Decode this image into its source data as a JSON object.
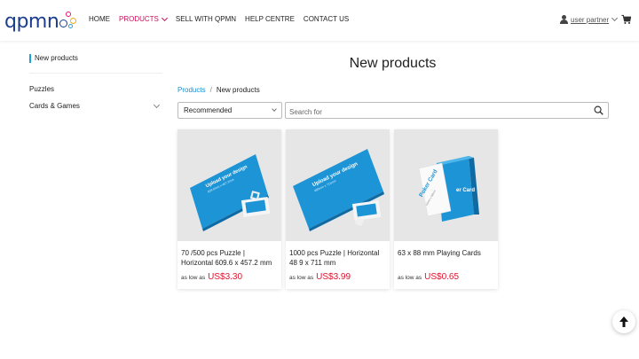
{
  "header": {
    "logo_text": "qpmn",
    "nav": [
      {
        "label": "HOME"
      },
      {
        "label": "PRODUCTS"
      },
      {
        "label": "SELL WITH QPMN"
      },
      {
        "label": "HELP CENTRE"
      },
      {
        "label": "CONTACT US"
      }
    ],
    "user_name": "user partner",
    "icons": {
      "user": "user-icon",
      "cart": "cart-icon"
    },
    "active_color": "#c8105a",
    "brand_color": "#1b3d8f"
  },
  "sidebar": {
    "current": "New products",
    "items": [
      {
        "label": "Puzzles"
      },
      {
        "label": "Cards & Games"
      }
    ]
  },
  "main": {
    "title": "New products",
    "breadcrumb": {
      "link": "Products",
      "separator": "/",
      "current": "New products"
    },
    "sort_value": "Recommended",
    "search_placeholder": "Search for",
    "products": [
      {
        "name": "70 /500 pcs Puzzle | Horizontal 609.6 x 457.2 mm",
        "price_label": "as low as",
        "price": "US$3.30",
        "image_text": "Upload your design",
        "image_subtext": "609.6mm x 457.2mm"
      },
      {
        "name": "1000 pcs Puzzle | Horizontal 48 9 x 711 mm",
        "price_label": "as low as",
        "price": "US$3.99",
        "image_text": "Upload your design",
        "image_subtext": "489mm x 711mm"
      },
      {
        "name": "63 x 88 mm Playing Cards",
        "price_label": "as low as",
        "price": "US$0.65",
        "image_text": "Poker Card",
        "image_subtext": "63mm x 88mm"
      }
    ],
    "price_color": "#e0142e",
    "link_color": "#1a8fcf"
  },
  "back_to_top_icon": "arrow-up-icon"
}
